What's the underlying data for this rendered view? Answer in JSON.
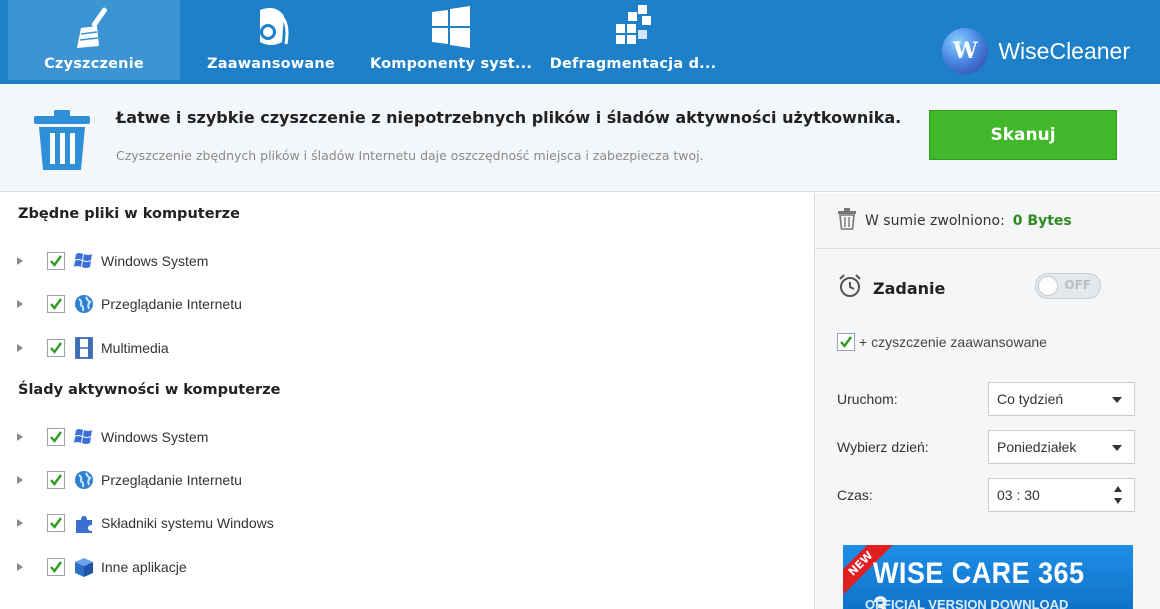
{
  "app": {
    "brand_name": "WiseCleaner",
    "brand_logo_letter": "W",
    "accent_color": "#1d80c9",
    "tabs": [
      {
        "label": "Czyszczenie",
        "icon": "broom-icon",
        "active": true
      },
      {
        "label": "Zaawansowane",
        "icon": "vacuum-cleaner-icon",
        "active": false
      },
      {
        "label": "Komponenty syst...",
        "icon": "windows-logo-icon",
        "active": false
      },
      {
        "label": "Defragmentacja d...",
        "icon": "defrag-blocks-icon",
        "active": false
      }
    ]
  },
  "header": {
    "headline": "Łatwe i szybkie czyszczenie z niepotrzebnych plików i śladów aktywności użytkownika.",
    "subline": "Czyszczenie zbędnych plików i śladów Internetu daje oszczędność miejsca i zabezpiecza twoj.",
    "scan_label": "Skanuj"
  },
  "left": {
    "section1_title": "Zbędne pliki w komputerze",
    "section1_items": [
      {
        "label": "Windows System",
        "icon": "windows-flag-icon",
        "checked": true
      },
      {
        "label": "Przeglądanie Internetu",
        "icon": "globe-icon",
        "checked": true
      },
      {
        "label": "Multimedia",
        "icon": "film-icon",
        "checked": true
      }
    ],
    "section2_title": "Ślady aktywności w komputerze",
    "section2_items": [
      {
        "label": "Windows System",
        "icon": "windows-flag-icon",
        "checked": true
      },
      {
        "label": "Przeglądanie Internetu",
        "icon": "globe-icon",
        "checked": true
      },
      {
        "label": "Składniki systemu Windows",
        "icon": "puzzle-icon",
        "checked": true
      },
      {
        "label": "Inne aplikacje",
        "icon": "box-icon",
        "checked": true
      }
    ]
  },
  "right": {
    "freed_label": "W sumie zwolniono:",
    "freed_value": "0 Bytes",
    "task_label": "Zadanie",
    "toggle_label": "OFF",
    "advanced_label": "+ czyszczenie zaawansowane",
    "run_label": "Uruchom:",
    "run_value": "Co tydzień",
    "day_label": "Wybierz dzień:",
    "day_value": "Poniedziałek",
    "time_label": "Czas:",
    "time_value": "03 : 30",
    "ad_ribbon": "NEW",
    "ad_title": "WISE CARE 365 3",
    "ad_sub": "OFFICIAL VERSION DOWNLOAD"
  }
}
